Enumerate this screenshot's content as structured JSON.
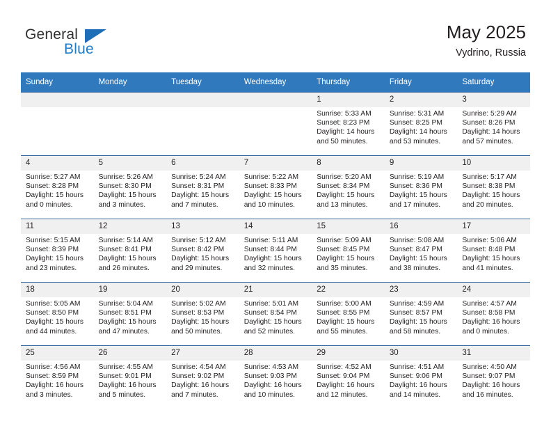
{
  "brand": {
    "name_part1": "General",
    "name_part2": "Blue"
  },
  "header": {
    "title": "May 2025",
    "subtitle": "Vydrino, Russia"
  },
  "colors": {
    "header_blue": "#3179bd",
    "brand_blue": "#1e7bc8",
    "daynum_band": "#f0f0f0",
    "text": "#231f20"
  },
  "weekday_headers": [
    "Sunday",
    "Monday",
    "Tuesday",
    "Wednesday",
    "Thursday",
    "Friday",
    "Saturday"
  ],
  "weeks": [
    [
      {
        "day": "",
        "lines": []
      },
      {
        "day": "",
        "lines": []
      },
      {
        "day": "",
        "lines": []
      },
      {
        "day": "",
        "lines": []
      },
      {
        "day": "1",
        "lines": [
          "Sunrise: 5:33 AM",
          "Sunset: 8:23 PM",
          "Daylight: 14 hours",
          "and 50 minutes."
        ]
      },
      {
        "day": "2",
        "lines": [
          "Sunrise: 5:31 AM",
          "Sunset: 8:25 PM",
          "Daylight: 14 hours",
          "and 53 minutes."
        ]
      },
      {
        "day": "3",
        "lines": [
          "Sunrise: 5:29 AM",
          "Sunset: 8:26 PM",
          "Daylight: 14 hours",
          "and 57 minutes."
        ]
      }
    ],
    [
      {
        "day": "4",
        "lines": [
          "Sunrise: 5:27 AM",
          "Sunset: 8:28 PM",
          "Daylight: 15 hours",
          "and 0 minutes."
        ]
      },
      {
        "day": "5",
        "lines": [
          "Sunrise: 5:26 AM",
          "Sunset: 8:30 PM",
          "Daylight: 15 hours",
          "and 3 minutes."
        ]
      },
      {
        "day": "6",
        "lines": [
          "Sunrise: 5:24 AM",
          "Sunset: 8:31 PM",
          "Daylight: 15 hours",
          "and 7 minutes."
        ]
      },
      {
        "day": "7",
        "lines": [
          "Sunrise: 5:22 AM",
          "Sunset: 8:33 PM",
          "Daylight: 15 hours",
          "and 10 minutes."
        ]
      },
      {
        "day": "8",
        "lines": [
          "Sunrise: 5:20 AM",
          "Sunset: 8:34 PM",
          "Daylight: 15 hours",
          "and 13 minutes."
        ]
      },
      {
        "day": "9",
        "lines": [
          "Sunrise: 5:19 AM",
          "Sunset: 8:36 PM",
          "Daylight: 15 hours",
          "and 17 minutes."
        ]
      },
      {
        "day": "10",
        "lines": [
          "Sunrise: 5:17 AM",
          "Sunset: 8:38 PM",
          "Daylight: 15 hours",
          "and 20 minutes."
        ]
      }
    ],
    [
      {
        "day": "11",
        "lines": [
          "Sunrise: 5:15 AM",
          "Sunset: 8:39 PM",
          "Daylight: 15 hours",
          "and 23 minutes."
        ]
      },
      {
        "day": "12",
        "lines": [
          "Sunrise: 5:14 AM",
          "Sunset: 8:41 PM",
          "Daylight: 15 hours",
          "and 26 minutes."
        ]
      },
      {
        "day": "13",
        "lines": [
          "Sunrise: 5:12 AM",
          "Sunset: 8:42 PM",
          "Daylight: 15 hours",
          "and 29 minutes."
        ]
      },
      {
        "day": "14",
        "lines": [
          "Sunrise: 5:11 AM",
          "Sunset: 8:44 PM",
          "Daylight: 15 hours",
          "and 32 minutes."
        ]
      },
      {
        "day": "15",
        "lines": [
          "Sunrise: 5:09 AM",
          "Sunset: 8:45 PM",
          "Daylight: 15 hours",
          "and 35 minutes."
        ]
      },
      {
        "day": "16",
        "lines": [
          "Sunrise: 5:08 AM",
          "Sunset: 8:47 PM",
          "Daylight: 15 hours",
          "and 38 minutes."
        ]
      },
      {
        "day": "17",
        "lines": [
          "Sunrise: 5:06 AM",
          "Sunset: 8:48 PM",
          "Daylight: 15 hours",
          "and 41 minutes."
        ]
      }
    ],
    [
      {
        "day": "18",
        "lines": [
          "Sunrise: 5:05 AM",
          "Sunset: 8:50 PM",
          "Daylight: 15 hours",
          "and 44 minutes."
        ]
      },
      {
        "day": "19",
        "lines": [
          "Sunrise: 5:04 AM",
          "Sunset: 8:51 PM",
          "Daylight: 15 hours",
          "and 47 minutes."
        ]
      },
      {
        "day": "20",
        "lines": [
          "Sunrise: 5:02 AM",
          "Sunset: 8:53 PM",
          "Daylight: 15 hours",
          "and 50 minutes."
        ]
      },
      {
        "day": "21",
        "lines": [
          "Sunrise: 5:01 AM",
          "Sunset: 8:54 PM",
          "Daylight: 15 hours",
          "and 52 minutes."
        ]
      },
      {
        "day": "22",
        "lines": [
          "Sunrise: 5:00 AM",
          "Sunset: 8:55 PM",
          "Daylight: 15 hours",
          "and 55 minutes."
        ]
      },
      {
        "day": "23",
        "lines": [
          "Sunrise: 4:59 AM",
          "Sunset: 8:57 PM",
          "Daylight: 15 hours",
          "and 58 minutes."
        ]
      },
      {
        "day": "24",
        "lines": [
          "Sunrise: 4:57 AM",
          "Sunset: 8:58 PM",
          "Daylight: 16 hours",
          "and 0 minutes."
        ]
      }
    ],
    [
      {
        "day": "25",
        "lines": [
          "Sunrise: 4:56 AM",
          "Sunset: 8:59 PM",
          "Daylight: 16 hours",
          "and 3 minutes."
        ]
      },
      {
        "day": "26",
        "lines": [
          "Sunrise: 4:55 AM",
          "Sunset: 9:01 PM",
          "Daylight: 16 hours",
          "and 5 minutes."
        ]
      },
      {
        "day": "27",
        "lines": [
          "Sunrise: 4:54 AM",
          "Sunset: 9:02 PM",
          "Daylight: 16 hours",
          "and 7 minutes."
        ]
      },
      {
        "day": "28",
        "lines": [
          "Sunrise: 4:53 AM",
          "Sunset: 9:03 PM",
          "Daylight: 16 hours",
          "and 10 minutes."
        ]
      },
      {
        "day": "29",
        "lines": [
          "Sunrise: 4:52 AM",
          "Sunset: 9:04 PM",
          "Daylight: 16 hours",
          "and 12 minutes."
        ]
      },
      {
        "day": "30",
        "lines": [
          "Sunrise: 4:51 AM",
          "Sunset: 9:06 PM",
          "Daylight: 16 hours",
          "and 14 minutes."
        ]
      },
      {
        "day": "31",
        "lines": [
          "Sunrise: 4:50 AM",
          "Sunset: 9:07 PM",
          "Daylight: 16 hours",
          "and 16 minutes."
        ]
      }
    ]
  ]
}
